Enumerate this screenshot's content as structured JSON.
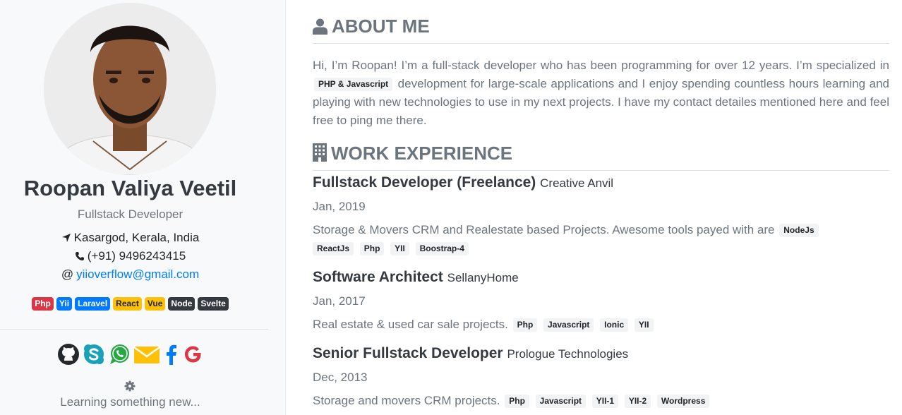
{
  "profile": {
    "name": "Roopan Valiya Veetil",
    "role": "Fullstack Developer",
    "location": "Kasargod, Kerala, India",
    "phone": "(+91) 9496243415",
    "email_prefix": "@",
    "email": "yiioverflow@gmail.com",
    "skills": [
      {
        "label": "Php",
        "color": "#dc3545"
      },
      {
        "label": "Yii",
        "color": "#007bff"
      },
      {
        "label": "Laravel",
        "color": "#007bff"
      },
      {
        "label": "React",
        "color": "#ffc107"
      },
      {
        "label": "Vue",
        "color": "#ffc107"
      },
      {
        "label": "Node",
        "color": "#343a40"
      },
      {
        "label": "Svelte",
        "color": "#343a40"
      }
    ],
    "socials": [
      "github-icon",
      "skype-icon",
      "whatsapp-icon",
      "envelope-icon",
      "facebook-icon",
      "google-icon"
    ],
    "status": "Learning something new..."
  },
  "about": {
    "heading": "ABOUT ME",
    "text_before": "Hi, I’m Roopan! I’m a full-stack developer who has been programming for over 12 years. I’m specialized in",
    "tag": "PHP & Javascript",
    "text_after": "development for large-scale applications and I enjoy spending countless hours learning and playing with new technologies to use in my next projects. I have my contact detailes mentioned here and feel free to ping me there."
  },
  "work": {
    "heading": "WORK EXPERIENCE",
    "jobs": [
      {
        "title": "Fullstack Developer (Freelance)",
        "company": "Creative Anvil",
        "date": "Jan, 2019",
        "description": "Storage & Movers CRM and Realestate based Projects. Awesome tools payed with are",
        "tags": [
          "NodeJs",
          "ReactJs",
          "Php",
          "YII",
          "Boostrap-4"
        ]
      },
      {
        "title": "Software Architect",
        "company": "SellanyHome",
        "date": "Jan, 2017",
        "description": "Real estate & used car sale projects.",
        "tags": [
          "Php",
          "Javascript",
          "Ionic",
          "YII"
        ]
      },
      {
        "title": "Senior Fullstack Developer",
        "company": "Prologue Technologies",
        "date": "Dec, 2013",
        "description": "Storage and movers CRM projects.",
        "tags": [
          "Php",
          "Javascript",
          "YII-1",
          "YII-2",
          "Wordpress"
        ]
      }
    ]
  }
}
